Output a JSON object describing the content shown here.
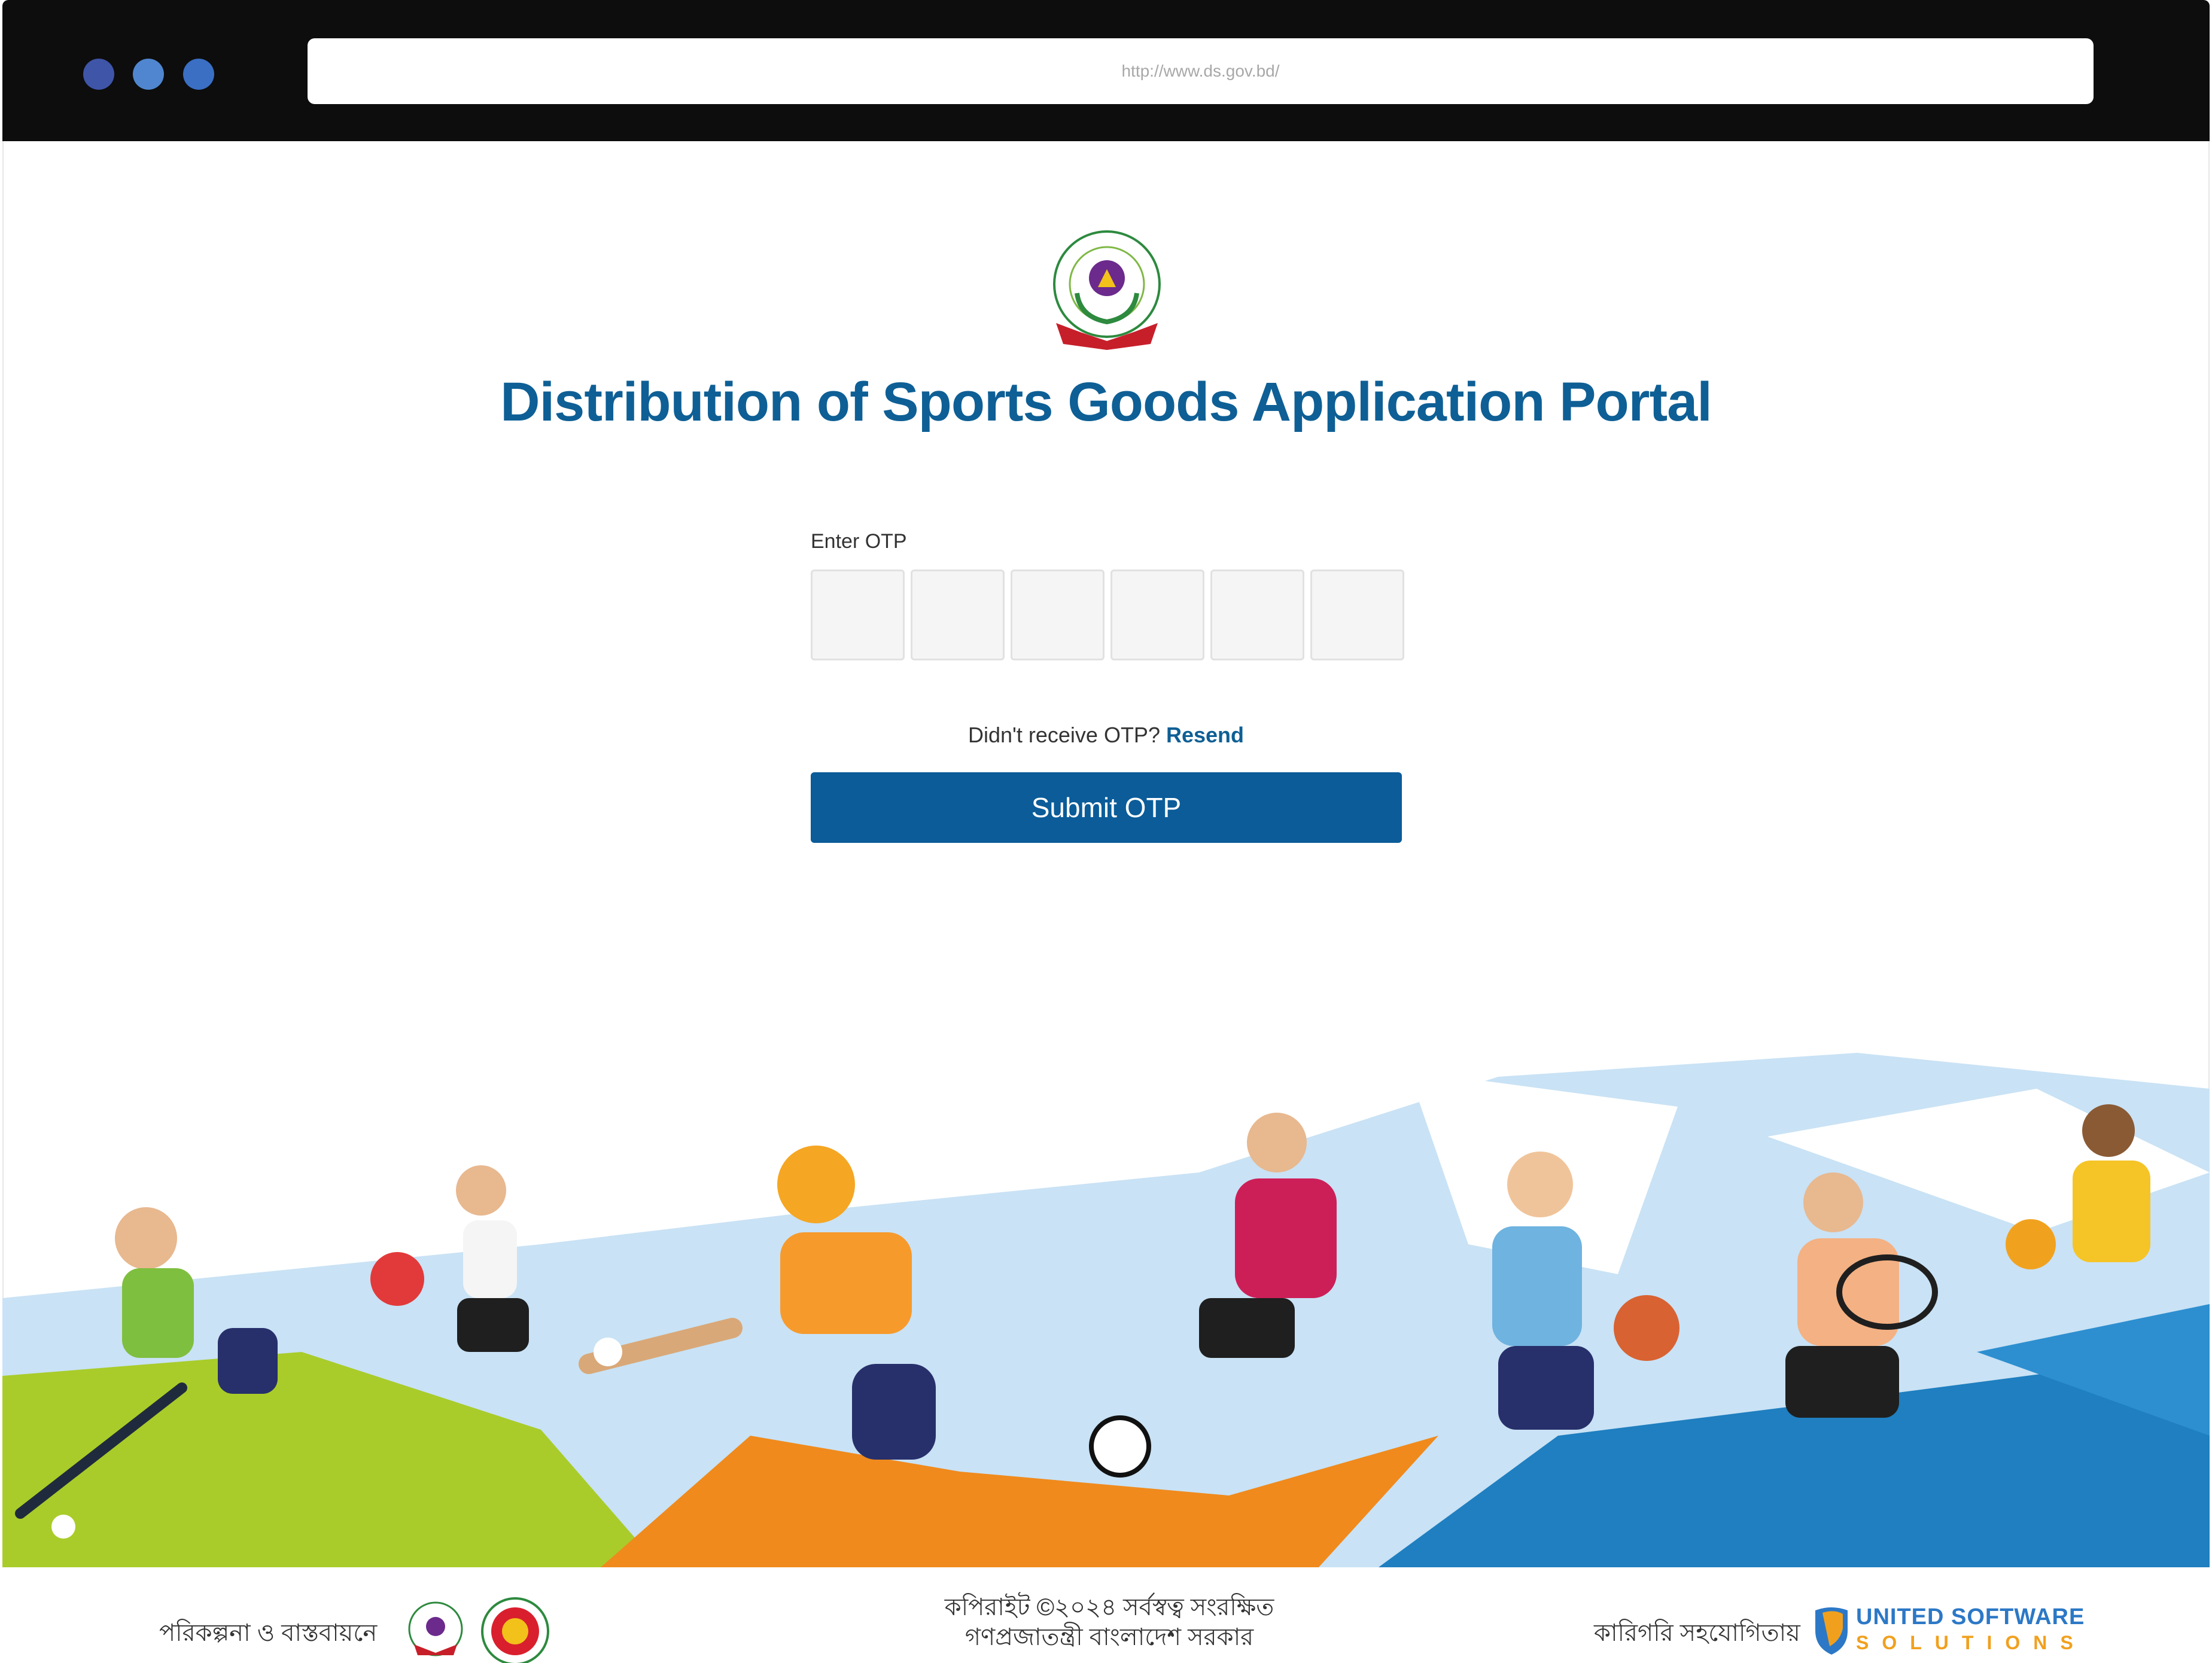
{
  "browser": {
    "url": "http://www.ds.gov.bd/"
  },
  "header": {
    "logo_icon": "directorate-of-sports-emblem-icon",
    "title": "Distribution of Sports Goods Application Portal"
  },
  "otp_form": {
    "label": "Enter OTP",
    "boxes": [
      "",
      "",
      "",
      "",
      "",
      ""
    ],
    "resend_prompt": "Didn't receive OTP?",
    "resend_link": "Resend",
    "submit_label": "Submit OTP"
  },
  "illustration": {
    "icon": "sports-players-illustration",
    "colors": {
      "green": "#a9cc2a",
      "orange": "#f08a1c",
      "blue": "#1f7fc0",
      "light_blue": "#c9e2f5"
    }
  },
  "footer": {
    "left_label": "পরিকল্পনা ও বাস্তবায়নে",
    "copyright_line1": "কপিরাইট ©২০২৪ সর্বস্বত্ব সংরক্ষিত",
    "copyright_line2": "গণপ্রজাতন্ত্রী বাংলাদেশ সরকার",
    "right_label": "কারিগরি সহযোগিতায়",
    "partner_name_line1": "UNITED SOFTWARE",
    "partner_name_line2": "SOLUTIONS"
  },
  "colors": {
    "primary": "#0b5c99",
    "title": "#0e5f95",
    "chrome": "#0d0d0d"
  }
}
